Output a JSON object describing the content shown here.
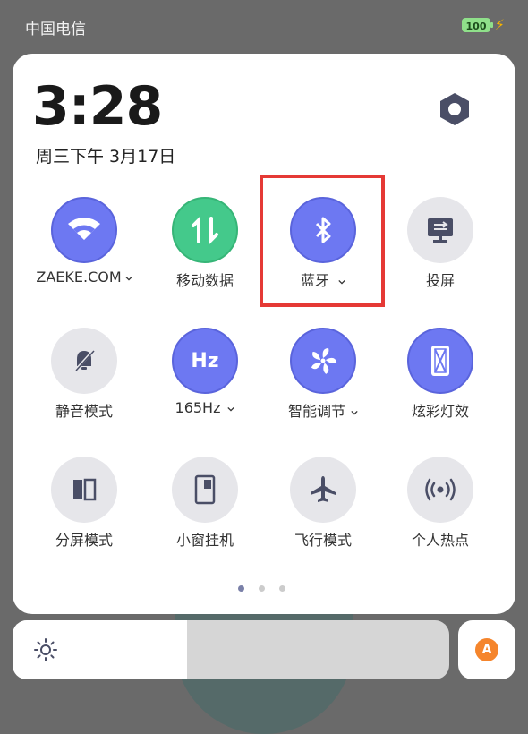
{
  "status_bar": {
    "carrier": "中国电信",
    "battery_level": "100"
  },
  "panel": {
    "time": "3:28",
    "date": "周三下午 3月17日",
    "tiles": [
      {
        "label": "ZAEKE.COM",
        "icon": "wifi-icon",
        "state": "on",
        "has_menu": true
      },
      {
        "label": "移动数据",
        "icon": "mobile-data-icon",
        "state": "on",
        "has_menu": false
      },
      {
        "label": "蓝牙",
        "icon": "bluetooth-icon",
        "state": "on",
        "has_menu": true
      },
      {
        "label": "投屏",
        "icon": "screen-cast-icon",
        "state": "off",
        "has_menu": false
      },
      {
        "label": "静音模式",
        "icon": "mute-bell-icon",
        "state": "off",
        "has_menu": false
      },
      {
        "label": "165Hz",
        "icon": "refresh-rate-icon",
        "icon_text": "Hz",
        "state": "on",
        "has_menu": true
      },
      {
        "label": "智能调节",
        "icon": "fan-icon",
        "state": "on",
        "has_menu": true
      },
      {
        "label": "炫彩灯效",
        "icon": "phone-light-icon",
        "state": "on",
        "has_menu": false
      },
      {
        "label": "分屏模式",
        "icon": "split-screen-icon",
        "state": "off",
        "has_menu": false
      },
      {
        "label": "小窗挂机",
        "icon": "small-window-icon",
        "state": "off",
        "has_menu": false
      },
      {
        "label": "飞行模式",
        "icon": "airplane-icon",
        "state": "off",
        "has_menu": false
      },
      {
        "label": "个人热点",
        "icon": "hotspot-icon",
        "state": "off",
        "has_menu": false
      }
    ],
    "page_indicator": {
      "total": 3,
      "current": 1
    }
  },
  "brightness": {
    "level": 0.4,
    "auto_label": "A"
  },
  "colors": {
    "active": "#6d78f2",
    "mobile_data": "#44c98b",
    "inactive": "#e6e6ea",
    "highlight": "#e53935",
    "auto_badge": "#f5852c"
  }
}
